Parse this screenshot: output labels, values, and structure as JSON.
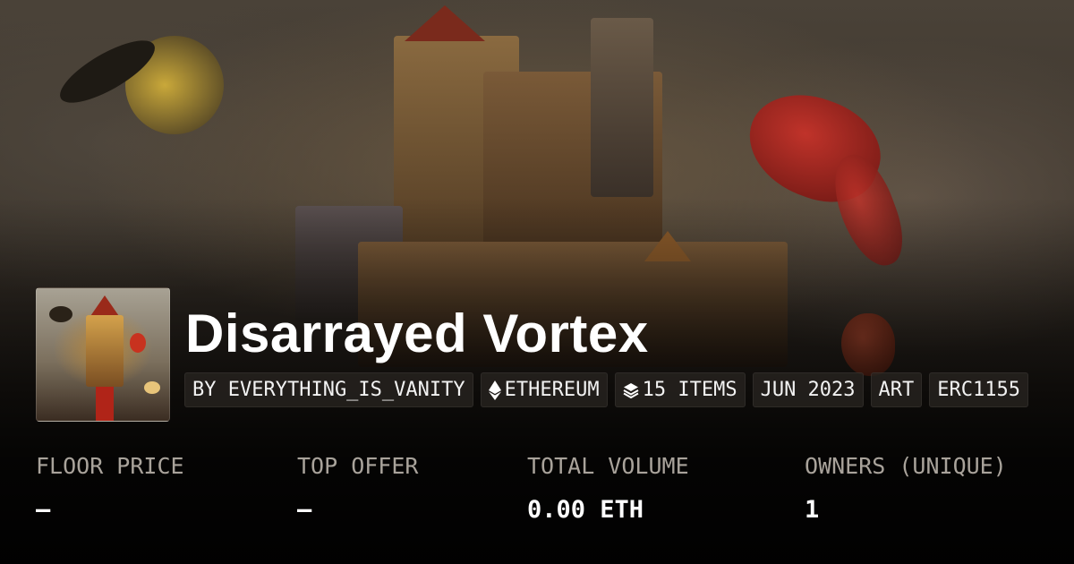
{
  "collection": {
    "name": "Disarrayed Vortex"
  },
  "tags": [
    {
      "label": "BY EVERYTHING_IS_VANITY",
      "icon": ""
    },
    {
      "label": "ETHEREUM",
      "icon": "ethereum-icon"
    },
    {
      "label": "15 ITEMS",
      "icon": "layers-icon"
    },
    {
      "label": "JUN 2023",
      "icon": ""
    },
    {
      "label": "ART",
      "icon": ""
    },
    {
      "label": "ERC1155",
      "icon": ""
    }
  ],
  "stats": [
    {
      "label": "FLOOR PRICE",
      "value": "–"
    },
    {
      "label": "TOP OFFER",
      "value": "–"
    },
    {
      "label": "TOTAL VOLUME",
      "value": "0.00 ETH"
    },
    {
      "label": "OWNERS (UNIQUE)",
      "value": "1"
    }
  ]
}
